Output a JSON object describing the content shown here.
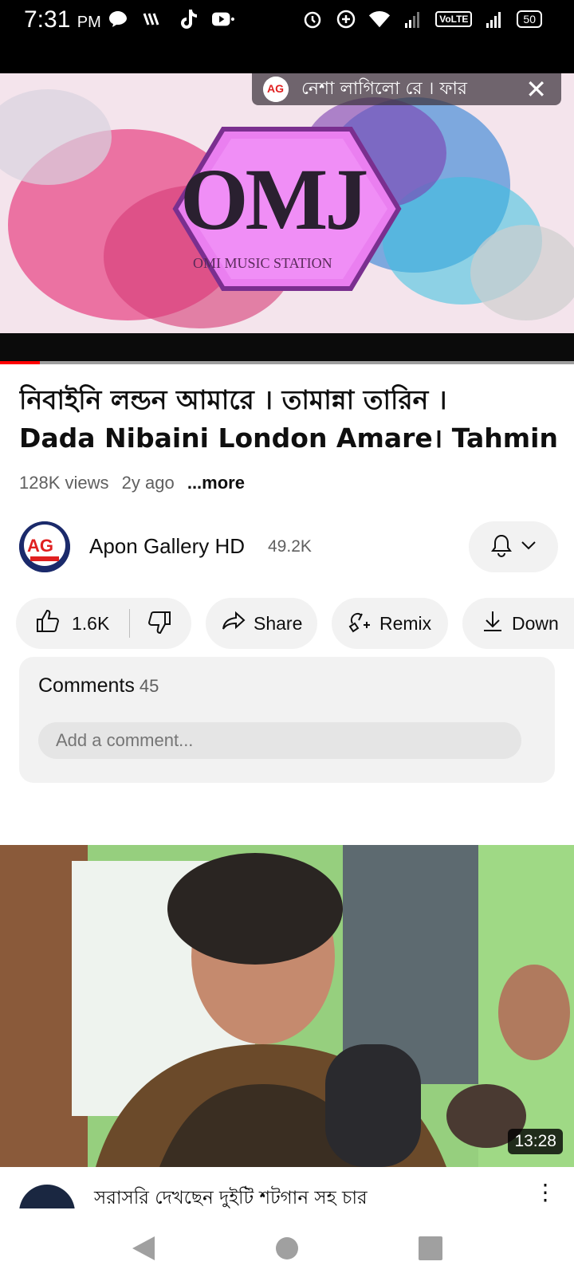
{
  "status_bar": {
    "time": "7:31",
    "ampm": "PM",
    "left_icons": [
      "message-icon",
      "wifi-calling-icon",
      "tiktok-icon",
      "youtube-icon"
    ],
    "right_icons": [
      "alarm-icon",
      "data-saver-icon",
      "wifi-icon",
      "signal-icon"
    ],
    "volte": "VoLTE",
    "battery": "50"
  },
  "player": {
    "now_playing_title": "নেশা লাগিলো রে । ফার",
    "close_icon": "close-icon",
    "logo_text": "OMJ",
    "logo_subtitle": "OMI MUSIC STATION",
    "progress": 0.07
  },
  "video": {
    "title_line1": "নিবাইনি লন্ডন আমারে । তামান্না তারিন ।",
    "title_line2": "Dada Nibaini London Amare। Tahmina T...",
    "views": "128K views",
    "age": "2y ago",
    "more": "...more"
  },
  "channel": {
    "name": "Apon Gallery HD",
    "subscribers": "49.2K",
    "avatar_text": "AG"
  },
  "actions": {
    "like_count": "1.6K",
    "share": "Share",
    "remix": "Remix",
    "download": "Down"
  },
  "comments": {
    "label": "Comments",
    "count": "45",
    "placeholder": "Add a comment..."
  },
  "recommended": {
    "duration": "13:28",
    "title": "সরাসরি দেখছেন দুইটি শটগান সহ চার"
  },
  "colors": {
    "accent": "#ff0000",
    "chip_bg": "#f2f2f2",
    "secondary_text": "#606060"
  }
}
